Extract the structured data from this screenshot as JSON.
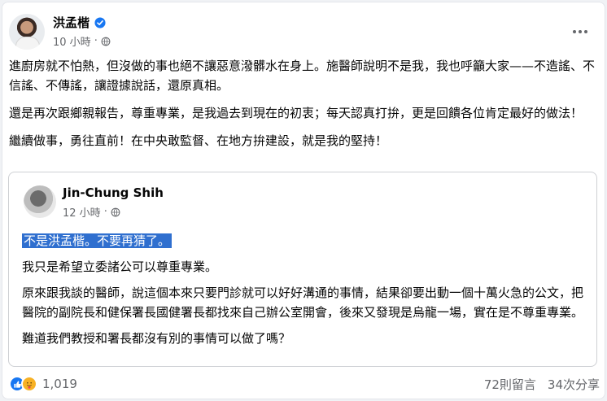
{
  "post": {
    "author": "洪孟楷",
    "time": "10 小時",
    "paragraphs": [
      "進廚房就不怕熱，但沒做的事也絕不讓惡意潑髒水在身上。施醫師說明不是我，我也呼籲大家——不造謠、不信謠、不傳謠，讓證據說話，還原真相。",
      "還是再次跟鄉親報告，尊重專業，是我過去到現在的初衷；每天認真打拚，更是回饋各位肯定最好的做法！",
      "繼續做事，勇往直前！在中央敢監督、在地方拚建設，就是我的堅持！"
    ]
  },
  "shared": {
    "author": "Jin-Chung Shih",
    "time": "12 小時",
    "highlight": "不是洪孟楷。不要再猜了。",
    "paragraphs": [
      "我只是希望立委諸公可以尊重專業。",
      "原來跟我談的醫師，說這個本來只要門診就可以好好溝通的事情，結果卻要出動一個十萬火急的公文，把醫院的副院長和健保署長國健署長都找來自己辦公室開會，後來又發現是烏龍一場，實在是不尊重專業。",
      "難道我們教授和署長都沒有別的事情可以做了嗎？"
    ]
  },
  "footer": {
    "reaction_count": "1,019",
    "comments": "72則留言",
    "shares": "34次分享"
  },
  "colors": {
    "verified": "#1877f2",
    "highlight_bg": "#2f6fcf",
    "secondary_text": "#65676b"
  }
}
